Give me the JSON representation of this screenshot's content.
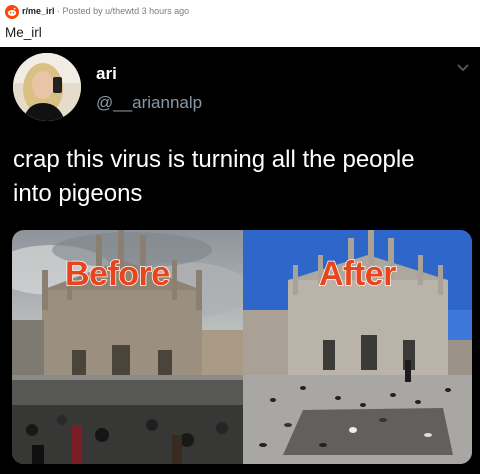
{
  "post": {
    "subreddit": "r/me_irl",
    "meta": "· Posted by u/thewtd 3 hours ago",
    "title": "Me_irl"
  },
  "tweet": {
    "display_name": "ari",
    "handle": "@__ariannalp",
    "text": "crap this virus is turning all the people into pigeons"
  },
  "media": {
    "before_label": "Before",
    "after_label": "After"
  },
  "colors": {
    "reddit_orange": "#ff4500",
    "tweet_background": "#000000",
    "handle_gray": "#8899a6",
    "label_red": "#e8451e"
  },
  "icons": [
    "reddit-logo-icon",
    "chevron-down-icon"
  ]
}
